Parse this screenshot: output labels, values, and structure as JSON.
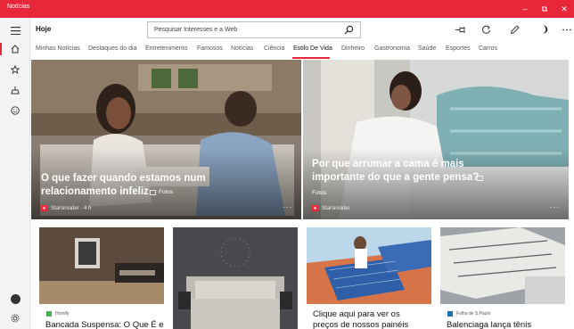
{
  "window": {
    "title": "Notícias",
    "controls": [
      "–",
      "⧉",
      "✕"
    ]
  },
  "header": {
    "title": "Hoje",
    "search_placeholder": "Pesquisar Interesses e a Web"
  },
  "tabs": [
    "Minhas Notícias",
    "Destaques do dia",
    "Entretenimento",
    "Famosos",
    "Notícias",
    "Ciência",
    "Estilo De Vida",
    "Dinheiro",
    "Gastronomia",
    "Saúde",
    "Esportes",
    "Carros"
  ],
  "active_tab": "Estilo De Vida",
  "hero": [
    {
      "headline_line1": "O que fazer quando estamos num",
      "headline_line2": "relacionamento infeliz",
      "tag": "Fotos",
      "source": "Starsinsider · 4 h"
    },
    {
      "headline_line1": "Por que arrumar a cama é mais",
      "headline_line2": "importante do que a gente pensa?",
      "tag": "Fotos",
      "source": "Starsinsider"
    }
  ],
  "cards": [
    {
      "source": "Homify",
      "title": "Bancada Suspensa: O Que É e"
    },
    {
      "source": "",
      "title": ""
    },
    {
      "source": "",
      "title_line1": "Clique aqui para ver os",
      "title_line2": "preços de nossos painéis"
    },
    {
      "source": "Folha de S.Paulo",
      "title": "Balenciaga lança tênis"
    }
  ],
  "colors": {
    "accent": "#e8273a",
    "rail_bg": "#f4f4f4"
  }
}
